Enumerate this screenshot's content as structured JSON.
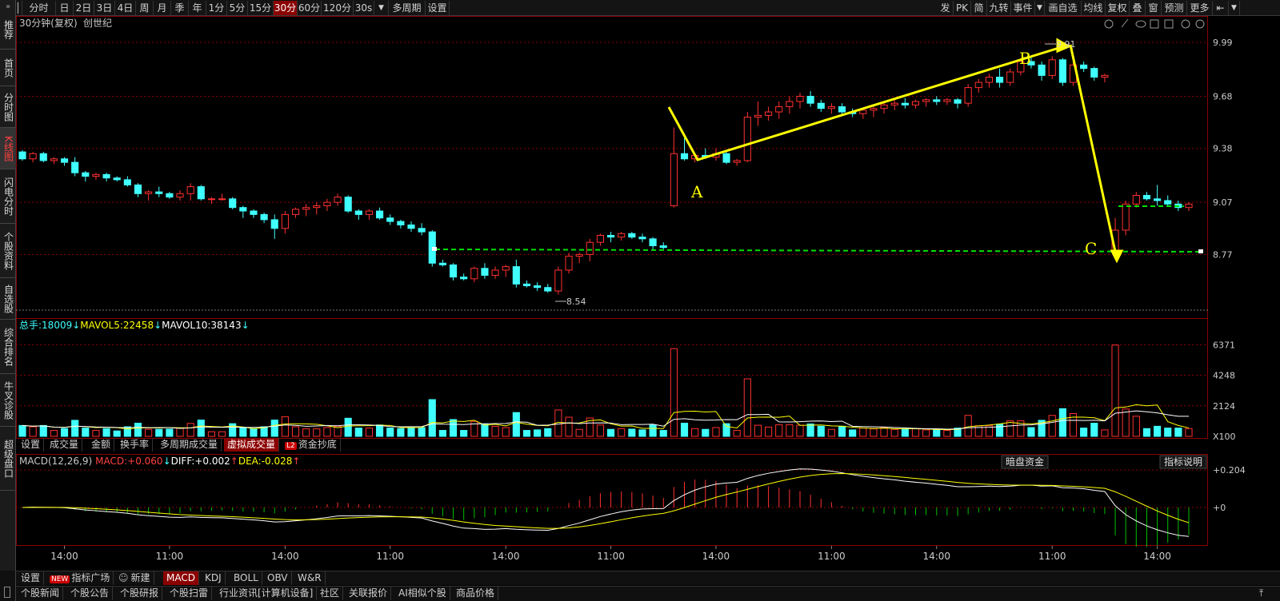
{
  "sidebar": {
    "items": [
      "推荐",
      "首页",
      "分时图",
      "K线图",
      "闪电分时",
      "个股资料",
      "自选股",
      "综合排名",
      "牛叉诊股",
      "超级盘口"
    ]
  },
  "toolbar": {
    "left_items": [
      "分时",
      "日",
      "2日",
      "3日",
      "4日",
      "周",
      "月",
      "季",
      "年",
      "1分",
      "5分",
      "15分",
      "30分",
      "60分",
      "120分",
      "30s",
      "多周期",
      "设置"
    ],
    "active": "30分",
    "right_items": [
      "发",
      "PK",
      "简",
      "九转",
      "事件",
      "画自选",
      "均线",
      "复权",
      "叠",
      "窗",
      "预测",
      "更多"
    ]
  },
  "header": {
    "title": "30分钟(复权)",
    "stock": "创世纪"
  },
  "price_axis": [
    "9.99",
    "9.68",
    "9.38",
    "9.07",
    "8.77"
  ],
  "low_marker": "8.54",
  "high_marker": "9.91",
  "annotations": [
    "A",
    "B",
    "C"
  ],
  "volume": {
    "label": "总手:",
    "total": "18009",
    "mavol5_label": "MAVOL5:",
    "mavol5": "22458",
    "mavol10_label": "MAVOL10:",
    "mavol10": "38143",
    "axis": [
      "6371",
      "4248",
      "2124",
      "X100"
    ]
  },
  "vol_tabs": [
    "设置",
    "成交量",
    "金额",
    "换手率",
    "多周期成交量",
    "虚拟成交量",
    "资金抄底"
  ],
  "vol_tab_active": "虚拟成交量",
  "macd": {
    "label": "MACD(12,26,9)",
    "macd_label": "MACD:",
    "macd": "+0.060",
    "diff_label": "DIFF:",
    "diff": "+0.002",
    "dea_label": "DEA:",
    "dea": "-0.028",
    "axis": [
      "+0.204",
      "+0"
    ],
    "btn_hidden_funds": "暗盘资金",
    "btn_help": "指标说明"
  },
  "time_axis": [
    "14:00",
    "11:00",
    "14:00",
    "11:00",
    "14:00",
    "11:00",
    "14:00",
    "11:00",
    "14:00",
    "11:00",
    "14:00"
  ],
  "indicator_tabs": [
    "设置",
    "指标广场",
    "新建",
    "MACD",
    "KDJ",
    "BOLL",
    "OBV",
    "W&R"
  ],
  "indicator_tab_active": "MACD",
  "news_tabs": [
    "个股新闻",
    "个股公告",
    "个股研报",
    "个股扫雷",
    "行业资讯[计算机设备]",
    "社区",
    "关联报价",
    "AI相似个股",
    "商品价格"
  ],
  "colors": {
    "up": "#ff3030",
    "down": "#40ffff",
    "ma": "#ffff00",
    "support": "#00e000"
  },
  "chart_data": {
    "type": "candlestick",
    "price_range": [
      8.45,
      10.05
    ],
    "candles": [
      [
        9.36,
        9.37,
        9.31,
        9.32
      ],
      [
        9.32,
        9.36,
        9.3,
        9.35
      ],
      [
        9.35,
        9.36,
        9.3,
        9.31
      ],
      [
        9.31,
        9.33,
        9.29,
        9.32
      ],
      [
        9.32,
        9.33,
        9.28,
        9.3
      ],
      [
        9.3,
        9.33,
        9.22,
        9.24
      ],
      [
        9.24,
        9.25,
        9.19,
        9.22
      ],
      [
        9.22,
        9.24,
        9.2,
        9.23
      ],
      [
        9.23,
        9.24,
        9.19,
        9.21
      ],
      [
        9.21,
        9.22,
        9.19,
        9.2
      ],
      [
        9.2,
        9.22,
        9.16,
        9.17
      ],
      [
        9.17,
        9.18,
        9.1,
        9.12
      ],
      [
        9.12,
        9.14,
        9.08,
        9.13
      ],
      [
        9.13,
        9.16,
        9.1,
        9.12
      ],
      [
        9.12,
        9.13,
        9.09,
        9.1
      ],
      [
        9.1,
        9.14,
        9.08,
        9.12
      ],
      [
        9.12,
        9.18,
        9.08,
        9.16
      ],
      [
        9.16,
        9.17,
        9.08,
        9.09
      ],
      [
        9.09,
        9.1,
        9.06,
        9.09
      ],
      [
        9.09,
        9.12,
        9.08,
        9.09
      ],
      [
        9.09,
        9.1,
        9.03,
        9.04
      ],
      [
        9.04,
        9.05,
        8.98,
        9.02
      ],
      [
        9.02,
        9.03,
        8.98,
        9.0
      ],
      [
        9.0,
        9.01,
        8.95,
        8.97
      ],
      [
        8.97,
        9.0,
        8.86,
        8.92
      ],
      [
        8.92,
        9.02,
        8.89,
        9.0
      ],
      [
        9.0,
        9.04,
        8.98,
        9.03
      ],
      [
        9.03,
        9.06,
        8.99,
        9.04
      ],
      [
        9.04,
        9.07,
        9.0,
        9.05
      ],
      [
        9.05,
        9.09,
        9.02,
        9.07
      ],
      [
        9.07,
        9.12,
        9.05,
        9.1
      ],
      [
        9.1,
        9.11,
        9.01,
        9.02
      ],
      [
        9.02,
        9.03,
        8.97,
        9.0
      ],
      [
        9.0,
        9.03,
        8.97,
        9.02
      ],
      [
        9.02,
        9.04,
        8.97,
        8.98
      ],
      [
        8.98,
        9.0,
        8.94,
        8.96
      ],
      [
        8.96,
        8.97,
        8.92,
        8.94
      ],
      [
        8.94,
        8.96,
        8.9,
        8.92
      ],
      [
        8.92,
        8.95,
        8.88,
        8.9
      ],
      [
        8.9,
        8.91,
        8.7,
        8.72
      ],
      [
        8.72,
        8.74,
        8.7,
        8.71
      ],
      [
        8.71,
        8.72,
        8.62,
        8.64
      ],
      [
        8.64,
        8.66,
        8.62,
        8.63
      ],
      [
        8.63,
        8.7,
        8.61,
        8.69
      ],
      [
        8.69,
        8.72,
        8.63,
        8.65
      ],
      [
        8.65,
        8.7,
        8.63,
        8.68
      ],
      [
        8.68,
        8.71,
        8.64,
        8.7
      ],
      [
        8.7,
        8.74,
        8.58,
        8.6
      ],
      [
        8.6,
        8.62,
        8.58,
        8.59
      ],
      [
        8.59,
        8.61,
        8.56,
        8.58
      ],
      [
        8.58,
        8.6,
        8.55,
        8.56
      ],
      [
        8.56,
        8.7,
        8.54,
        8.68
      ],
      [
        8.68,
        8.78,
        8.66,
        8.76
      ],
      [
        8.76,
        8.78,
        8.72,
        8.77
      ],
      [
        8.77,
        8.86,
        8.73,
        8.84
      ],
      [
        8.84,
        8.89,
        8.82,
        8.88
      ],
      [
        8.88,
        8.9,
        8.84,
        8.87
      ],
      [
        8.87,
        8.9,
        8.85,
        8.89
      ],
      [
        8.89,
        8.9,
        8.86,
        8.87
      ],
      [
        8.87,
        8.89,
        8.84,
        8.86
      ],
      [
        8.86,
        8.87,
        8.8,
        8.82
      ],
      [
        8.82,
        8.84,
        8.8,
        8.81
      ],
      [
        9.05,
        9.5,
        9.04,
        9.35
      ],
      [
        9.35,
        9.44,
        9.31,
        9.32
      ],
      [
        9.32,
        9.35,
        9.3,
        9.34
      ],
      [
        9.34,
        9.38,
        9.32,
        9.33
      ],
      [
        9.33,
        9.38,
        9.31,
        9.35
      ],
      [
        9.35,
        9.36,
        9.29,
        9.3
      ],
      [
        9.3,
        9.32,
        9.28,
        9.31
      ],
      [
        9.31,
        9.59,
        9.3,
        9.56
      ],
      [
        9.56,
        9.65,
        9.51,
        9.57
      ],
      [
        9.57,
        9.62,
        9.54,
        9.59
      ],
      [
        9.59,
        9.65,
        9.55,
        9.62
      ],
      [
        9.62,
        9.68,
        9.58,
        9.65
      ],
      [
        9.65,
        9.7,
        9.61,
        9.68
      ],
      [
        9.68,
        9.71,
        9.62,
        9.64
      ],
      [
        9.64,
        9.66,
        9.59,
        9.61
      ],
      [
        9.61,
        9.64,
        9.58,
        9.62
      ],
      [
        9.62,
        9.64,
        9.57,
        9.59
      ],
      [
        9.59,
        9.61,
        9.56,
        9.58
      ],
      [
        9.58,
        9.61,
        9.55,
        9.6
      ],
      [
        9.6,
        9.63,
        9.56,
        9.61
      ],
      [
        9.61,
        9.65,
        9.58,
        9.63
      ],
      [
        9.63,
        9.66,
        9.6,
        9.64
      ],
      [
        9.64,
        9.67,
        9.61,
        9.63
      ],
      [
        9.63,
        9.66,
        9.61,
        9.65
      ],
      [
        9.65,
        9.67,
        9.62,
        9.66
      ],
      [
        9.66,
        9.68,
        9.63,
        9.65
      ],
      [
        9.65,
        9.67,
        9.63,
        9.66
      ],
      [
        9.66,
        9.67,
        9.61,
        9.64
      ],
      [
        9.64,
        9.75,
        9.62,
        9.73
      ],
      [
        9.73,
        9.78,
        9.7,
        9.76
      ],
      [
        9.76,
        9.81,
        9.73,
        9.79
      ],
      [
        9.79,
        9.84,
        9.73,
        9.76
      ],
      [
        9.76,
        9.84,
        9.74,
        9.82
      ],
      [
        9.82,
        9.9,
        9.8,
        9.88
      ],
      [
        9.88,
        9.91,
        9.84,
        9.86
      ],
      [
        9.86,
        9.88,
        9.77,
        9.8
      ],
      [
        9.8,
        9.91,
        9.78,
        9.89
      ],
      [
        9.89,
        9.9,
        9.74,
        9.76
      ],
      [
        9.76,
        9.88,
        9.74,
        9.86
      ],
      [
        9.86,
        9.88,
        9.82,
        9.84
      ],
      [
        9.84,
        9.85,
        9.77,
        9.79
      ],
      [
        9.79,
        9.81,
        9.76,
        9.8
      ],
      [
        8.79,
        8.98,
        8.77,
        8.91
      ],
      [
        8.91,
        9.08,
        8.88,
        9.06
      ],
      [
        9.06,
        9.13,
        9.04,
        9.11
      ],
      [
        9.11,
        9.13,
        9.08,
        9.09
      ],
      [
        9.09,
        9.17,
        9.05,
        9.08
      ],
      [
        9.08,
        9.11,
        9.05,
        9.06
      ],
      [
        9.06,
        9.08,
        9.02,
        9.04
      ],
      [
        9.04,
        9.07,
        9.02,
        9.06
      ]
    ],
    "volume_range": [
      0,
      7000
    ]
  }
}
